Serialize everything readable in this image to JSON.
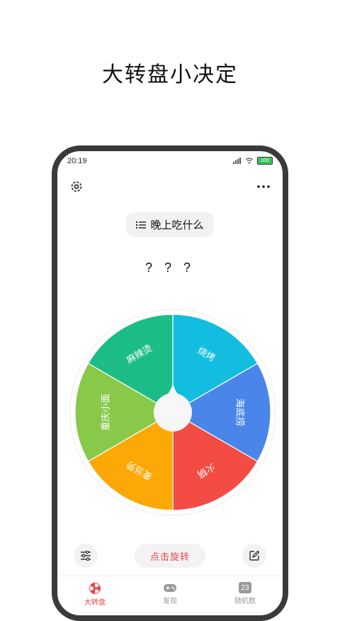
{
  "promo": {
    "title": "大转盘小决定"
  },
  "status_bar": {
    "time": "20:19",
    "battery": "100"
  },
  "topic": {
    "label": "晚上吃什么"
  },
  "result": {
    "text": "? ? ?"
  },
  "wheel": {
    "segments": [
      {
        "label": "海底捞",
        "color": "#4a86ea"
      },
      {
        "label": "火锅",
        "color": "#f24c45"
      },
      {
        "label": "麦当劳",
        "color": "#fca806"
      },
      {
        "label": "重庆小面",
        "color": "#88c94a"
      },
      {
        "label": "麻辣烫",
        "color": "#1cbc86"
      },
      {
        "label": "烧烤",
        "color": "#13bde0"
      }
    ]
  },
  "actions": {
    "spin_label": "点击旋转"
  },
  "nav": {
    "items": [
      {
        "label": "大转盘",
        "active": true
      },
      {
        "label": "发现",
        "active": false
      },
      {
        "label": "随机数",
        "active": false,
        "badge": "23"
      }
    ]
  },
  "colors": {
    "accent": "#e8464a",
    "inactive": "#999999"
  }
}
